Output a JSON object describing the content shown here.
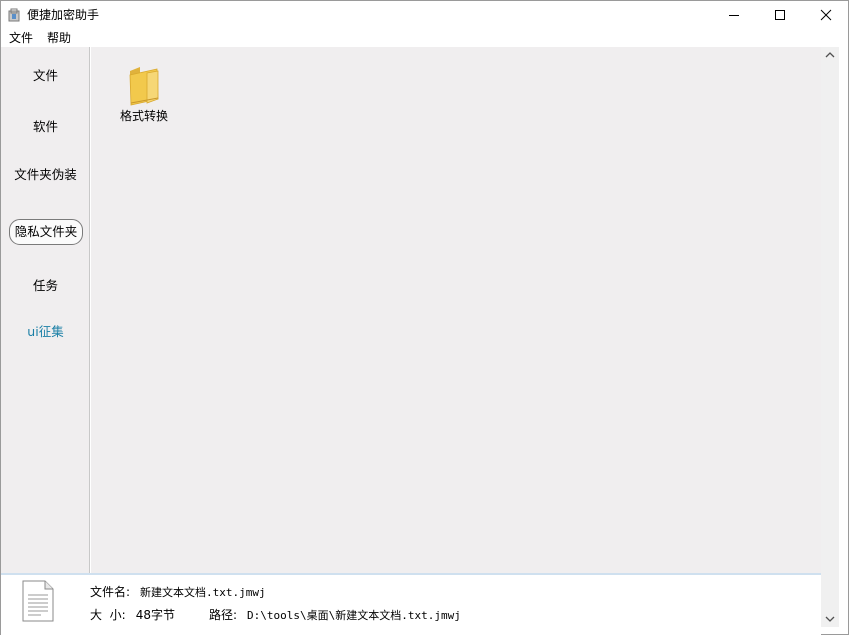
{
  "window": {
    "title": "便捷加密助手",
    "icon": "app-icon"
  },
  "menu": {
    "items": [
      {
        "label": "文件"
      },
      {
        "label": "帮助"
      }
    ]
  },
  "sidebar": {
    "items": [
      {
        "label": "文件"
      },
      {
        "label": "软件"
      },
      {
        "label": "文件夹伪装"
      },
      {
        "label": "隐私文件夹",
        "selected": true
      },
      {
        "label": "任务"
      },
      {
        "label": "ui征集",
        "color": "#1a7fa6"
      }
    ]
  },
  "content": {
    "items": [
      {
        "label": "格式转换",
        "icon": "folder-icon"
      }
    ]
  },
  "status": {
    "file_name_label": "文件名:",
    "file_name": "新建文本文档.txt.jmwj",
    "size_label": "大  小:",
    "size": "48字节",
    "path_label": "路径:",
    "path": "D:\\tools\\桌面\\新建文本文档.txt.jmwj"
  },
  "colors": {
    "sidebar_bg": "#f0eeef",
    "accent_link": "#1a7fa6",
    "folder": "#f2c94c"
  }
}
